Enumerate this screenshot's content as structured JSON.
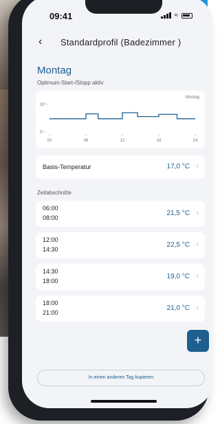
{
  "status": {
    "time": "09:41"
  },
  "nav": {
    "title": "Standardprofil (Badezimmer )"
  },
  "day": {
    "title": "Montag",
    "subtitle": "Optimum-Start-/Stopp aktiv"
  },
  "chart_data": {
    "type": "line",
    "title": "",
    "day_label": "Montag",
    "ytick_labels": [
      "30°-",
      "5°-"
    ],
    "ylim": [
      5,
      30
    ],
    "x_ticks": [
      "00",
      "06",
      "12",
      "18",
      "24"
    ],
    "xlim": [
      0,
      24
    ],
    "series": [
      {
        "points": [
          [
            0,
            17.0
          ],
          [
            6,
            17.0
          ],
          [
            6,
            21.5
          ],
          [
            8,
            21.5
          ],
          [
            8,
            17.0
          ],
          [
            12,
            17.0
          ],
          [
            12,
            22.5
          ],
          [
            14.5,
            22.5
          ],
          [
            14.5,
            19.0
          ],
          [
            18,
            19.0
          ],
          [
            18,
            21.0
          ],
          [
            21,
            21.0
          ],
          [
            21,
            17.0
          ],
          [
            24,
            17.0
          ]
        ],
        "color": "#1b5f93"
      }
    ]
  },
  "base": {
    "label": "Basis-Temperatur",
    "value": "17,0 °C"
  },
  "section": {
    "label": "Zeitabschnitte"
  },
  "periods": [
    {
      "start": "06:00",
      "end": "08:00",
      "value": "21,5 °C"
    },
    {
      "start": "12:00",
      "end": "14:30",
      "value": "22,5 °C"
    },
    {
      "start": "14:30",
      "end": "18:00",
      "value": "19,0 °C"
    },
    {
      "start": "18:00",
      "end": "21:00",
      "value": "21,0 °C"
    }
  ],
  "actions": {
    "add": "+",
    "copy": "In einen anderen Tag kopieren"
  },
  "colors": {
    "accent": "#1b5f93",
    "background": "#f3f4f7"
  },
  "icons": {
    "back": "chevron-left-icon",
    "chevron": "chevron-right-icon"
  }
}
